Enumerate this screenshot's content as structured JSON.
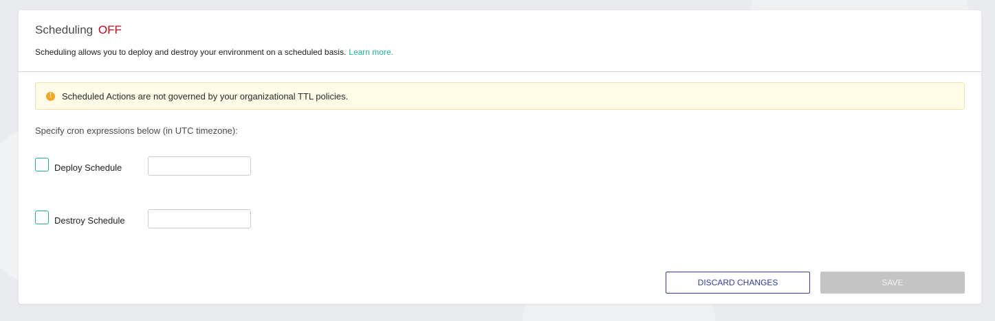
{
  "header": {
    "title": "Scheduling",
    "state": "OFF",
    "description": "Scheduling allows you to deploy and destroy your environment on a scheduled basis.",
    "learn_more": "Learn more."
  },
  "alert": {
    "icon": "warning-icon",
    "icon_glyph": "!",
    "text": "Scheduled Actions are not governed by your organizational TTL policies."
  },
  "instructions": "Specify cron expressions below (in UTC timezone):",
  "schedules": [
    {
      "label": "Deploy Schedule",
      "checked": false,
      "value": ""
    },
    {
      "label": "Destroy Schedule",
      "checked": false,
      "value": ""
    }
  ],
  "actions": {
    "discard_label": "DISCARD CHANGES",
    "save_label": "SAVE"
  },
  "colors": {
    "state_off": "#d0021b",
    "link": "#1ab394",
    "accent": "#2f3aa8",
    "alert_bg": "#fffbe6",
    "alert_icon": "#f5a623",
    "disabled_button": "#c4c4c4"
  }
}
